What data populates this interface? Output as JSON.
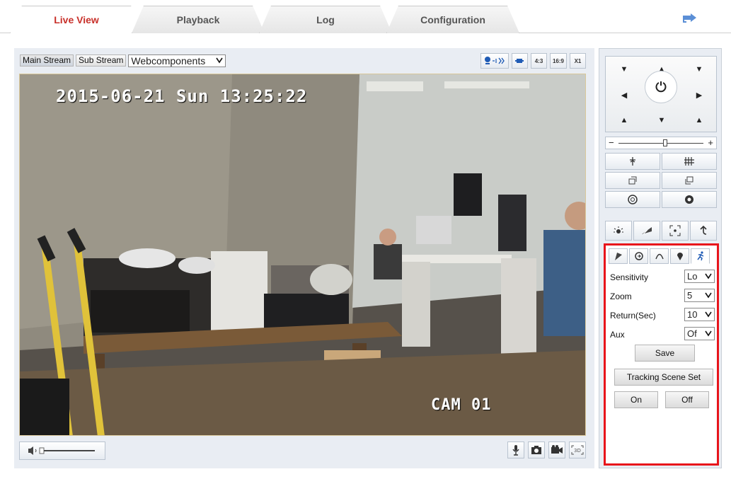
{
  "tabs": [
    {
      "label": "Live View",
      "active": true
    },
    {
      "label": "Playback",
      "active": false
    },
    {
      "label": "Log",
      "active": false
    },
    {
      "label": "Configuration",
      "active": false
    }
  ],
  "stream": {
    "main_label": "Main Stream",
    "sub_label": "Sub Stream",
    "plugin_value": "Webcomponents"
  },
  "view_tools": {
    "ratio_4_3": "4:3",
    "ratio_16_9": "16:9",
    "zoom_x1": "X1"
  },
  "video": {
    "osd_datetime": "2015-06-21 Sun 13:25:22",
    "osd_camera": "CAM 01"
  },
  "ptz": {
    "speed_minus": "−",
    "speed_plus": "+",
    "speed_level": 0.55
  },
  "tracking": {
    "fields": [
      {
        "label": "Sensitivity",
        "value": "Lo"
      },
      {
        "label": "Zoom",
        "value": "5"
      },
      {
        "label": "Return(Sec)",
        "value": "10"
      },
      {
        "label": "Aux",
        "value": "Of"
      }
    ],
    "save_label": "Save",
    "scene_label": "Tracking Scene Set",
    "on_label": "On",
    "off_label": "Off"
  },
  "colors": {
    "active_tab_text": "#c8302a",
    "highlight_border": "#e8141b",
    "panel_bg": "#e9edf3"
  }
}
